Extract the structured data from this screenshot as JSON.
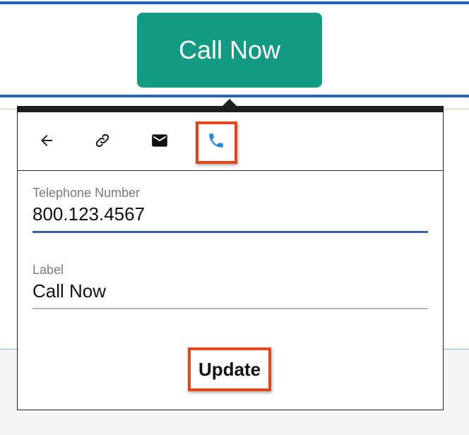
{
  "page": {
    "call_button_label": "Call Now",
    "accent_color": "#129a82"
  },
  "toolbar": {
    "tools": [
      {
        "icon": "arrow-left-icon",
        "active": false
      },
      {
        "icon": "link-icon",
        "active": false
      },
      {
        "icon": "mail-icon",
        "active": false
      },
      {
        "icon": "phone-icon",
        "active": true,
        "color": "#1e88e5"
      }
    ]
  },
  "form": {
    "telephone": {
      "label": "Telephone Number",
      "value": "800.123.4567",
      "focused": true
    },
    "label_field": {
      "label": "Label",
      "value": "Call Now",
      "focused": false
    },
    "update_label": "Update"
  },
  "colors": {
    "highlight": "#e2461d",
    "focus_underline": "#3a5fa8",
    "page_blue": "#2563b8"
  }
}
